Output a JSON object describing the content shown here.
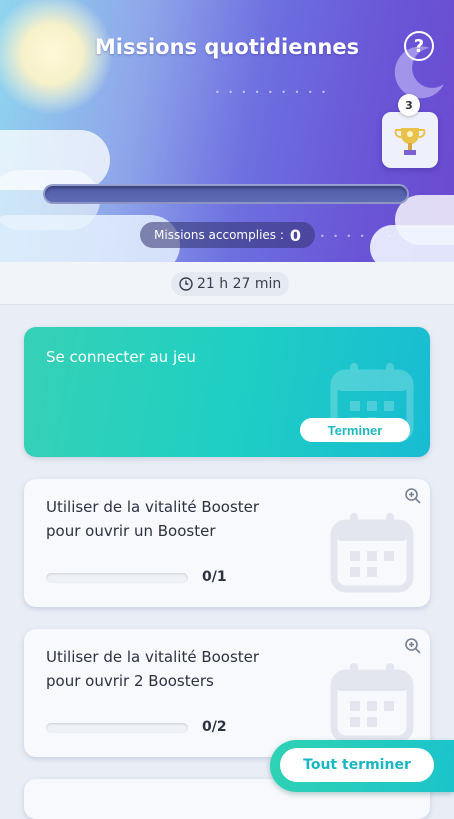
{
  "header": {
    "title": "Missions quotidiennes",
    "help_label": "?",
    "trophy_count": "3",
    "progress_fraction": 0,
    "completed_label": "Missions accomplies :",
    "completed_count": "0"
  },
  "timer": {
    "text": "21 h 27 min"
  },
  "missions": [
    {
      "title": "Se connecter au jeu",
      "button": "Terminer"
    },
    {
      "title_line1": "Utiliser de la vitalité Booster",
      "title_line2": "pour ouvrir un Booster",
      "progress": "0/1",
      "fraction": 0
    },
    {
      "title_line1": "Utiliser de la vitalité Booster",
      "title_line2": "pour ouvrir 2 Boosters",
      "progress": "0/2",
      "fraction": 0
    }
  ],
  "footer": {
    "complete_all": "Tout terminer"
  },
  "colors": {
    "accent": "#1fcfc3",
    "header_purple": "#6a55d6",
    "sun": "#fff9d8"
  },
  "icons": [
    "help-icon",
    "moon-icon",
    "trophy-icon",
    "clock-icon",
    "calendar-icon",
    "zoom-icon"
  ]
}
